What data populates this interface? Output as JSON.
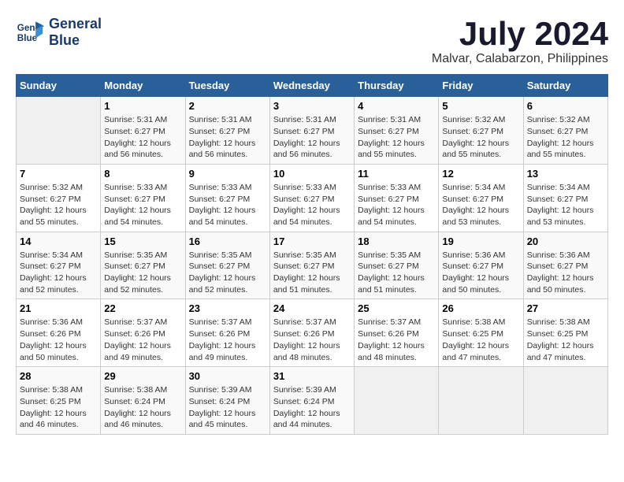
{
  "header": {
    "logo_line1": "General",
    "logo_line2": "Blue",
    "month_year": "July 2024",
    "location": "Malvar, Calabarzon, Philippines"
  },
  "weekdays": [
    "Sunday",
    "Monday",
    "Tuesday",
    "Wednesday",
    "Thursday",
    "Friday",
    "Saturday"
  ],
  "weeks": [
    [
      {
        "day": "",
        "info": ""
      },
      {
        "day": "1",
        "info": "Sunrise: 5:31 AM\nSunset: 6:27 PM\nDaylight: 12 hours\nand 56 minutes."
      },
      {
        "day": "2",
        "info": "Sunrise: 5:31 AM\nSunset: 6:27 PM\nDaylight: 12 hours\nand 56 minutes."
      },
      {
        "day": "3",
        "info": "Sunrise: 5:31 AM\nSunset: 6:27 PM\nDaylight: 12 hours\nand 56 minutes."
      },
      {
        "day": "4",
        "info": "Sunrise: 5:31 AM\nSunset: 6:27 PM\nDaylight: 12 hours\nand 55 minutes."
      },
      {
        "day": "5",
        "info": "Sunrise: 5:32 AM\nSunset: 6:27 PM\nDaylight: 12 hours\nand 55 minutes."
      },
      {
        "day": "6",
        "info": "Sunrise: 5:32 AM\nSunset: 6:27 PM\nDaylight: 12 hours\nand 55 minutes."
      }
    ],
    [
      {
        "day": "7",
        "info": "Sunrise: 5:32 AM\nSunset: 6:27 PM\nDaylight: 12 hours\nand 55 minutes."
      },
      {
        "day": "8",
        "info": "Sunrise: 5:33 AM\nSunset: 6:27 PM\nDaylight: 12 hours\nand 54 minutes."
      },
      {
        "day": "9",
        "info": "Sunrise: 5:33 AM\nSunset: 6:27 PM\nDaylight: 12 hours\nand 54 minutes."
      },
      {
        "day": "10",
        "info": "Sunrise: 5:33 AM\nSunset: 6:27 PM\nDaylight: 12 hours\nand 54 minutes."
      },
      {
        "day": "11",
        "info": "Sunrise: 5:33 AM\nSunset: 6:27 PM\nDaylight: 12 hours\nand 54 minutes."
      },
      {
        "day": "12",
        "info": "Sunrise: 5:34 AM\nSunset: 6:27 PM\nDaylight: 12 hours\nand 53 minutes."
      },
      {
        "day": "13",
        "info": "Sunrise: 5:34 AM\nSunset: 6:27 PM\nDaylight: 12 hours\nand 53 minutes."
      }
    ],
    [
      {
        "day": "14",
        "info": "Sunrise: 5:34 AM\nSunset: 6:27 PM\nDaylight: 12 hours\nand 52 minutes."
      },
      {
        "day": "15",
        "info": "Sunrise: 5:35 AM\nSunset: 6:27 PM\nDaylight: 12 hours\nand 52 minutes."
      },
      {
        "day": "16",
        "info": "Sunrise: 5:35 AM\nSunset: 6:27 PM\nDaylight: 12 hours\nand 52 minutes."
      },
      {
        "day": "17",
        "info": "Sunrise: 5:35 AM\nSunset: 6:27 PM\nDaylight: 12 hours\nand 51 minutes."
      },
      {
        "day": "18",
        "info": "Sunrise: 5:35 AM\nSunset: 6:27 PM\nDaylight: 12 hours\nand 51 minutes."
      },
      {
        "day": "19",
        "info": "Sunrise: 5:36 AM\nSunset: 6:27 PM\nDaylight: 12 hours\nand 50 minutes."
      },
      {
        "day": "20",
        "info": "Sunrise: 5:36 AM\nSunset: 6:27 PM\nDaylight: 12 hours\nand 50 minutes."
      }
    ],
    [
      {
        "day": "21",
        "info": "Sunrise: 5:36 AM\nSunset: 6:26 PM\nDaylight: 12 hours\nand 50 minutes."
      },
      {
        "day": "22",
        "info": "Sunrise: 5:37 AM\nSunset: 6:26 PM\nDaylight: 12 hours\nand 49 minutes."
      },
      {
        "day": "23",
        "info": "Sunrise: 5:37 AM\nSunset: 6:26 PM\nDaylight: 12 hours\nand 49 minutes."
      },
      {
        "day": "24",
        "info": "Sunrise: 5:37 AM\nSunset: 6:26 PM\nDaylight: 12 hours\nand 48 minutes."
      },
      {
        "day": "25",
        "info": "Sunrise: 5:37 AM\nSunset: 6:26 PM\nDaylight: 12 hours\nand 48 minutes."
      },
      {
        "day": "26",
        "info": "Sunrise: 5:38 AM\nSunset: 6:25 PM\nDaylight: 12 hours\nand 47 minutes."
      },
      {
        "day": "27",
        "info": "Sunrise: 5:38 AM\nSunset: 6:25 PM\nDaylight: 12 hours\nand 47 minutes."
      }
    ],
    [
      {
        "day": "28",
        "info": "Sunrise: 5:38 AM\nSunset: 6:25 PM\nDaylight: 12 hours\nand 46 minutes."
      },
      {
        "day": "29",
        "info": "Sunrise: 5:38 AM\nSunset: 6:24 PM\nDaylight: 12 hours\nand 46 minutes."
      },
      {
        "day": "30",
        "info": "Sunrise: 5:39 AM\nSunset: 6:24 PM\nDaylight: 12 hours\nand 45 minutes."
      },
      {
        "day": "31",
        "info": "Sunrise: 5:39 AM\nSunset: 6:24 PM\nDaylight: 12 hours\nand 44 minutes."
      },
      {
        "day": "",
        "info": ""
      },
      {
        "day": "",
        "info": ""
      },
      {
        "day": "",
        "info": ""
      }
    ]
  ]
}
